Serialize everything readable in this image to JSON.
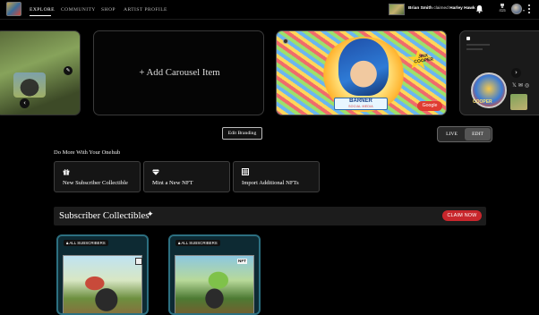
{
  "nav": {
    "links": [
      "EXPLORE",
      "COMMUNITY",
      "SHOP",
      "ARTIST PROFILE"
    ],
    "active": "EXPLORE",
    "claim": {
      "user": "Brian Smith",
      "action": "claimed",
      "item": "Harley Hawk"
    },
    "points": {
      "value": "415"
    }
  },
  "carousel": {
    "add_label": "+ Add Carousel Item",
    "featured": {
      "badge": "JINX COOPER",
      "banner_title": "BARNER",
      "banner_subtitle": "SOCIAL MEDIA",
      "button": "Google"
    },
    "side_card": {
      "label": "COOPER"
    }
  },
  "branding": {
    "edit_label": "Edit Branding"
  },
  "mode_toggle": {
    "live": "LIVE",
    "edit": "EDIT",
    "selected": "EDIT"
  },
  "do_more": {
    "title": "Do More With Your Onehub",
    "actions": [
      {
        "label": "New Subscriber Collectible",
        "icon": "gift-icon"
      },
      {
        "label": "Mint a New NFT",
        "icon": "diamond-icon"
      },
      {
        "label": "Import Additional NFTs",
        "icon": "grid-icon"
      }
    ]
  },
  "subscriber": {
    "title": "Subscriber Collectibles",
    "claim_label": "CLAIM NOW",
    "items": [
      {
        "badge": "ALL SUBSCRIBERS"
      },
      {
        "badge": "ALL SUBSCRIBERS",
        "tag": "NFT"
      }
    ]
  },
  "colors": {
    "accent_red": "#c8262c",
    "card_border": "#2c6f80",
    "background": "#000000"
  }
}
